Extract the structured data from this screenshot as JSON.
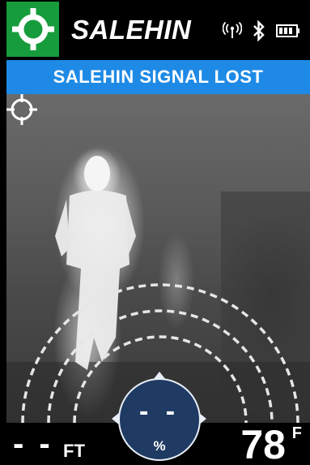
{
  "header": {
    "title": "SALEHIN",
    "target_icon": "crosshair-target-icon",
    "status_icons": [
      "signal-icon",
      "bluetooth-icon",
      "battery-icon"
    ],
    "accent_color": "#169c3c"
  },
  "banner": {
    "text": "SALEHIN SIGNAL LOST",
    "color": "#1e8ae6"
  },
  "feed": {
    "reticle_icon": "crosshair-reticle-icon",
    "range_rings": 3
  },
  "readouts": {
    "distance_value": "- -",
    "distance_unit": "FT",
    "signal_value": "- -",
    "signal_unit": "%",
    "temperature_value": "78",
    "temperature_unit": "F"
  }
}
